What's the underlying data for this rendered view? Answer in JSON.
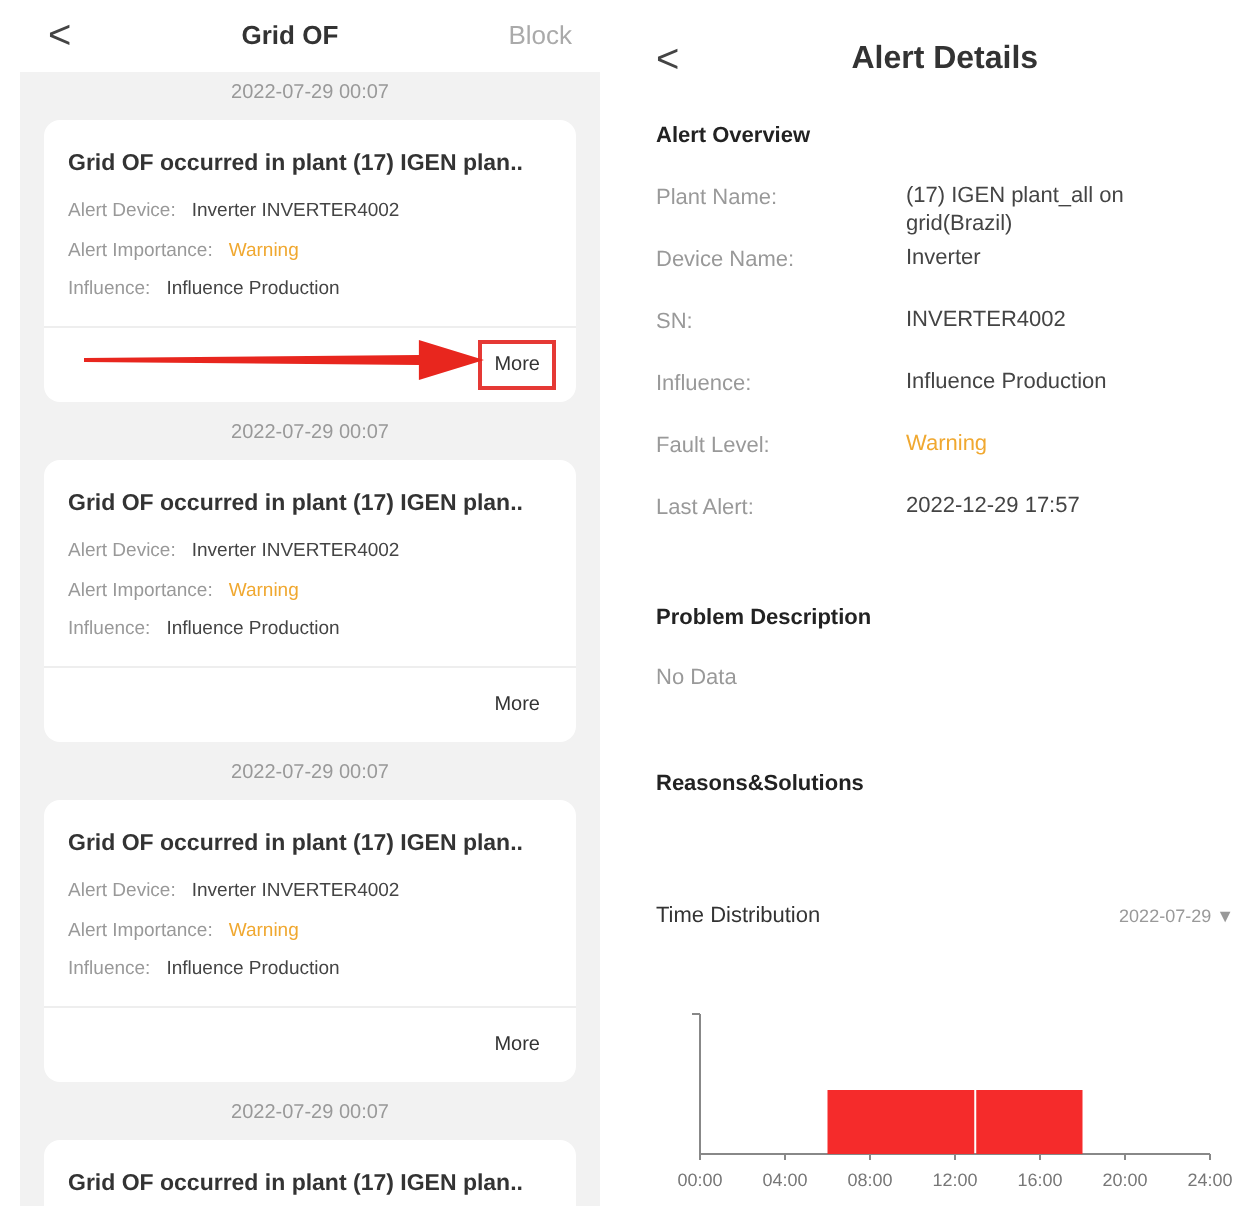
{
  "left_screen": {
    "header": {
      "back": "<",
      "title": "Grid OF",
      "action": "Block"
    },
    "alerts": [
      {
        "time": "2022-07-29 00:07",
        "title": "Grid OF occurred in plant (17) IGEN plan..",
        "fields": [
          {
            "label": "Alert Device:",
            "value": "Inverter INVERTER4002",
            "kind": "plain"
          },
          {
            "label": "Alert Importance:",
            "value": "Warning",
            "kind": "warning"
          },
          {
            "label": "Influence:",
            "value": "Influence Production",
            "kind": "plain"
          }
        ],
        "more": "More",
        "highlighted": true
      },
      {
        "time": "2022-07-29 00:07",
        "title": "Grid OF occurred in plant (17) IGEN plan..",
        "fields": [
          {
            "label": "Alert Device:",
            "value": "Inverter INVERTER4002",
            "kind": "plain"
          },
          {
            "label": "Alert Importance:",
            "value": "Warning",
            "kind": "warning"
          },
          {
            "label": "Influence:",
            "value": "Influence Production",
            "kind": "plain"
          }
        ],
        "more": "More",
        "highlighted": false
      },
      {
        "time": "2022-07-29 00:07",
        "title": "Grid OF occurred in plant (17) IGEN plan..",
        "fields": [
          {
            "label": "Alert Device:",
            "value": "Inverter INVERTER4002",
            "kind": "plain"
          },
          {
            "label": "Alert Importance:",
            "value": "Warning",
            "kind": "warning"
          },
          {
            "label": "Influence:",
            "value": "Influence Production",
            "kind": "plain"
          }
        ],
        "more": "More",
        "highlighted": false
      },
      {
        "time": "2022-07-29 00:07",
        "title": "Grid OF occurred in plant (17) IGEN plan.."
      }
    ]
  },
  "right_screen": {
    "header": {
      "back": "<",
      "title": "Alert Details"
    },
    "overview": {
      "heading": "Alert Overview",
      "rows": [
        {
          "label": "Plant Name:",
          "value": "(17) IGEN plant_all on grid(Brazil)",
          "kind": "plain"
        },
        {
          "label": "Device Name:",
          "value": "Inverter",
          "kind": "plain"
        },
        {
          "label": "SN:",
          "value": "INVERTER4002",
          "kind": "plain"
        },
        {
          "label": "Influence:",
          "value": "Influence Production",
          "kind": "plain"
        },
        {
          "label": "Fault Level:",
          "value": "Warning",
          "kind": "warning"
        },
        {
          "label": "Last Alert:",
          "value": "2022-12-29 17:57",
          "kind": "plain"
        }
      ]
    },
    "problem": {
      "heading": "Problem Description",
      "text": "No Data"
    },
    "reasons": {
      "heading": "Reasons&Solutions"
    },
    "time_distribution": {
      "title": "Time Distribution",
      "date": "2022-07-29",
      "dropdown": "▼",
      "x_labels": [
        "00:00",
        "04:00",
        "08:00",
        "12:00",
        "16:00",
        "20:00",
        "24:00"
      ]
    }
  }
}
